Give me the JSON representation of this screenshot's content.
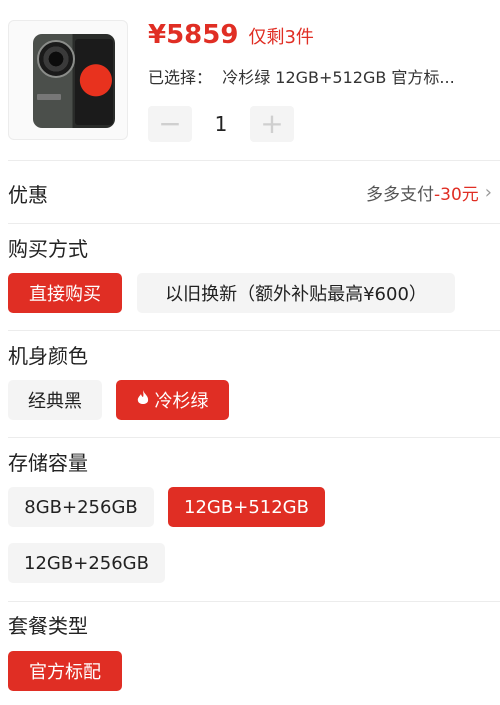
{
  "product": {
    "price": "¥5859",
    "stock": "仅剩3件",
    "selected_label": "已选择：",
    "selected_value": "冷杉绿 12GB+512GB 官方标..."
  },
  "quantity": {
    "minus": "−",
    "value": "1",
    "plus": "+"
  },
  "discount": {
    "title": "优惠",
    "pay_label": "多多支付",
    "amount": "-30元",
    "chevron": "›"
  },
  "purchase": {
    "title": "购买方式",
    "options": [
      "直接购买",
      "以旧换新（额外补贴最高¥600）"
    ]
  },
  "color": {
    "title": "机身颜色",
    "options": [
      "经典黑",
      "冷杉绿"
    ],
    "selected_icon": "fire-icon"
  },
  "storage": {
    "title": "存储容量",
    "options": [
      "8GB+256GB",
      "12GB+512GB",
      "12GB+256GB"
    ]
  },
  "package": {
    "title": "套餐类型",
    "options": [
      "官方标配"
    ]
  },
  "colors": {
    "accent": "#e02e24",
    "option_bg": "#f4f4f4"
  }
}
